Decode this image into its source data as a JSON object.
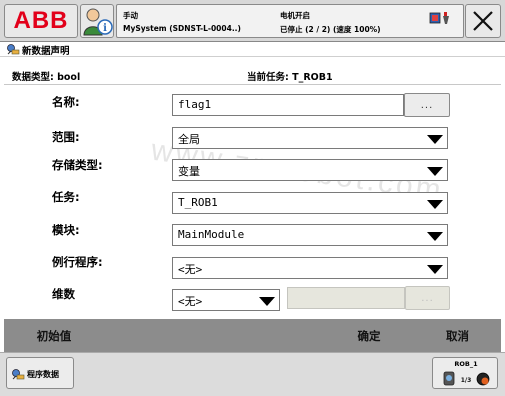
{
  "topbar": {
    "logo": "ABB",
    "mode": "手动",
    "system": "MySystem (SDNST-L-0004..)",
    "motor": "电机开启",
    "program_state": "已停止 (2 / 2) (速度 100%)"
  },
  "title": {
    "text": "新数据声明",
    "icon": "data-declaration-icon"
  },
  "info": {
    "data_type": "数据类型: bool",
    "current_task": "当前任务: T_ROB1"
  },
  "form": {
    "name": {
      "label": "名称:",
      "value": "flag1",
      "button": "..."
    },
    "scope": {
      "label": "范围:",
      "value": "全局"
    },
    "storage": {
      "label": "存储类型:",
      "value": "变量"
    },
    "task": {
      "label": "任务:",
      "value": "T_ROB1"
    },
    "module": {
      "label": "模块:",
      "value": "MainModule"
    },
    "routine": {
      "label": "例行程序:",
      "value": "<无>"
    },
    "dimensions": {
      "label": "维数",
      "value": "<无>",
      "input_value": "",
      "button": "..."
    }
  },
  "watermark": "www.zn-robot.com",
  "commands": {
    "initial_value": "初始值",
    "ok": "确定",
    "cancel": "取消"
  },
  "taskbar": {
    "program_data": "程序数据",
    "quickset_label": "ROB_1",
    "quickset_sub": "1/3"
  },
  "colors": {
    "abb_red": "#e2001a",
    "command_bar": "#8c8c8c",
    "taskbar": "#dcdcdc",
    "disabled_field": "#e6e6dd"
  }
}
